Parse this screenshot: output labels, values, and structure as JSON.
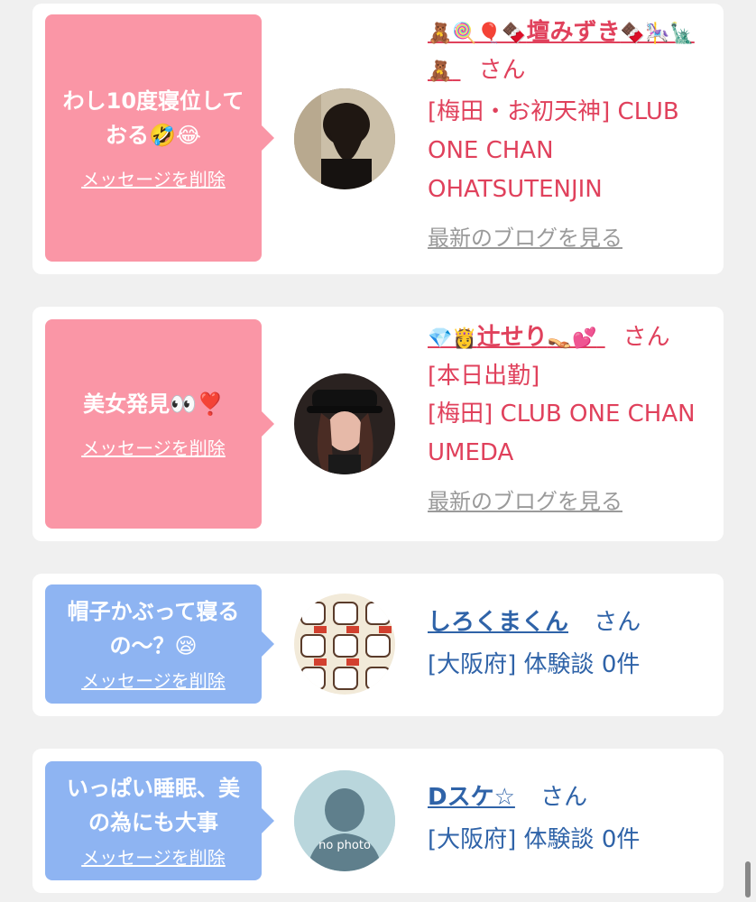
{
  "cards": [
    {
      "bubble_text": "わし10度寝位しておる🤣😂",
      "delete_label": "メッセージを削除",
      "name_prefix": "🧸🍭🎈🍫",
      "name": "壇みずき",
      "name_suffix": "🍫🎠🗽🧸",
      "san": "さん",
      "shop": "[梅田・お初天神] CLUB ONE CHAN OHATSUTENJIN",
      "blog_label": "最新のブログを見る"
    },
    {
      "bubble_text": "美女発見👀❣️",
      "delete_label": "メッセージを削除",
      "name_prefix": "💎👸",
      "name": "辻せり",
      "name_suffix": "👡💕",
      "san": "さん",
      "attendance": "[本日出勤]",
      "shop": "[梅田] CLUB ONE CHAN UMEDA",
      "blog_label": "最新のブログを見る"
    },
    {
      "bubble_text": "帽子かぶって寝るの～？😪",
      "delete_label": "メッセージを削除",
      "name": "しろくまくん",
      "san": "さん",
      "detail": "[大阪府] 体験談 0件"
    },
    {
      "bubble_text": "いっぱい睡眠、美の為にも大事",
      "delete_label": "メッセージを削除",
      "name": "Dスケ☆",
      "san": "さん",
      "detail": "[大阪府] 体験談 0件",
      "avatar_text": "no photo"
    }
  ],
  "colors": {
    "pink_bubble": "#fa96a6",
    "blue_bubble": "#8eb4f2",
    "pink_text": "#e0415c",
    "blue_text": "#2f63a8"
  }
}
